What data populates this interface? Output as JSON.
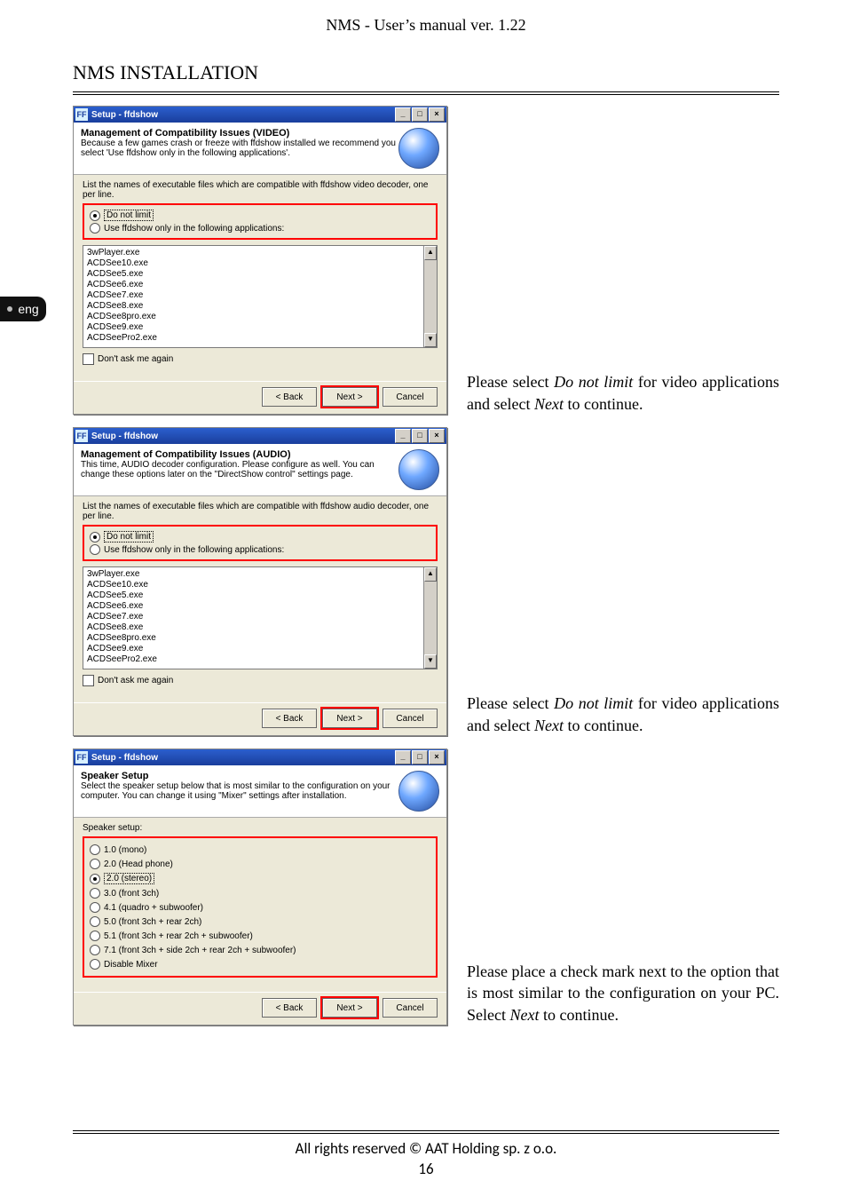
{
  "doc": {
    "header": "NMS - User’s manual ver. 1.22",
    "section": "NMS INSTALLATION",
    "lang_tab": "eng",
    "copyright": "All rights reserved © AAT Holding sp. z o.o.",
    "page": "16"
  },
  "common": {
    "back": "< Back",
    "next": "Next >",
    "cancel": "Cancel",
    "dont_ask": "Don't ask me again"
  },
  "apps": [
    "3wPlayer.exe",
    "ACDSee10.exe",
    "ACDSee5.exe",
    "ACDSee6.exe",
    "ACDSee7.exe",
    "ACDSee8.exe",
    "ACDSee8pro.exe",
    "ACDSee9.exe",
    "ACDSeePro2.exe"
  ],
  "dlg1": {
    "title": "Setup - ffdshow",
    "heading": "Management of Compatibility Issues (VIDEO)",
    "sub": "Because a few games crash or freeze with ffdshow installed we recommend you select 'Use ffdshow only in the following applications'.",
    "intro": "List the names of executable files which are compatible with ffdshow video decoder, one per line.",
    "opt1": "Do not limit",
    "opt2": "Use ffdshow only in the following applications:"
  },
  "dlg2": {
    "title": "Setup - ffdshow",
    "heading": "Management of Compatibility Issues (AUDIO)",
    "sub": "This time, AUDIO decoder configuration. Please configure as well. You can change these options later on the \"DirectShow control\" settings page.",
    "intro": "List the names of executable files which are compatible with ffdshow audio decoder, one per line.",
    "opt1": "Do not limit",
    "opt2": "Use ffdshow only in the following applications:"
  },
  "dlg3": {
    "title": "Setup - ffdshow",
    "heading": "Speaker Setup",
    "sub": "Select the speaker setup below that is most similar to the configuration on your computer. You can change it using \"Mixer\" settings after installation.",
    "label": "Speaker setup:",
    "opts": [
      "1.0 (mono)",
      "2.0 (Head phone)",
      "2.0 (stereo)",
      "3.0 (front 3ch)",
      "4.1 (quadro + subwoofer)",
      "5.0 (front 3ch + rear 2ch)",
      "5.1 (front 3ch + rear 2ch + subwoofer)",
      "7.1 (front 3ch + side 2ch + rear 2ch + subwoofer)",
      "Disable Mixer"
    ]
  },
  "captions": {
    "c1a": "Please select",
    "dnl": "Do not limit",
    "c1b": "for video applications and select",
    "next": "Next",
    "c1c": "to continue.",
    "c3a": "Please place a check mark next to the option that is most similar to the configuration on your PC. Select",
    "c3b": "to continue."
  }
}
